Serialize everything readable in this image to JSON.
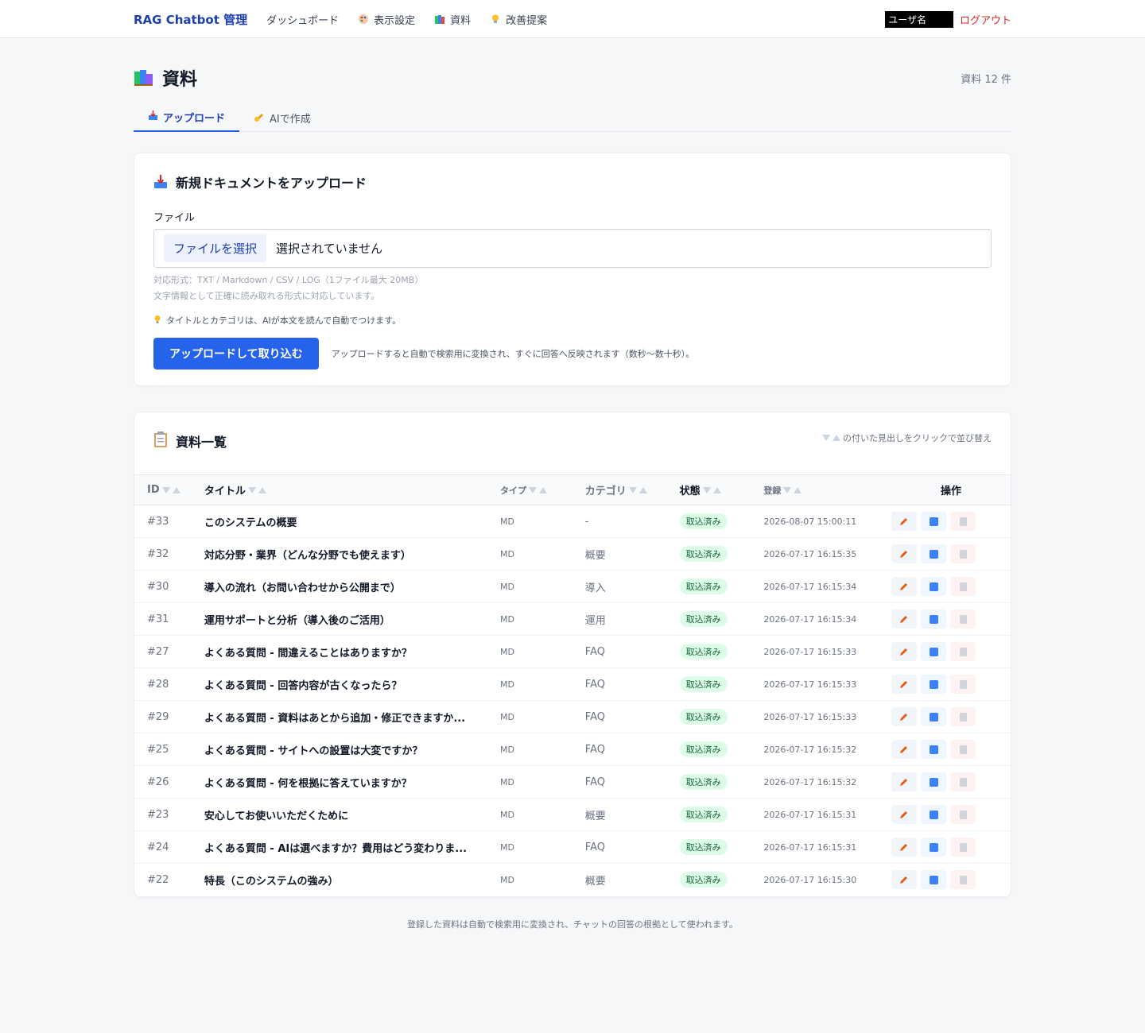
{
  "nav": {
    "brand": "RAG Chatbot 管理",
    "links": [
      {
        "label": "ダッシュボード",
        "icon": ""
      },
      {
        "label": "表示設定",
        "icon": "palette-icon"
      },
      {
        "label": "資料",
        "icon": "books-icon"
      },
      {
        "label": "改善提案",
        "icon": "lightbulb-icon"
      }
    ],
    "username": "ユーザ名",
    "logout": "ログアウト"
  },
  "page": {
    "title": "資料",
    "count": "資料 12 件"
  },
  "tabs": [
    {
      "label": "アップロード",
      "icon": "inbox-tray-icon",
      "active": true
    },
    {
      "label": "AIで作成",
      "icon": "writing-hand-icon",
      "active": false
    }
  ],
  "upload": {
    "title": "新規ドキュメントをアップロード",
    "file_label": "ファイル",
    "file_button": "ファイルを選択",
    "file_status": "選択されていません",
    "hint_formats": "対応形式：TXT / Markdown / CSV / LOG（1ファイル最大 20MB）",
    "hint_text": "文字情報として正確に読み取れる形式に対応しています。",
    "tip": "タイトルとカテゴリは、AIが本文を読んで自動でつけます。",
    "submit": "アップロードして取り込む",
    "submit_note": "アップロードすると自動で検索用に変換され、すぐに回答へ反映されます（数秒〜数十秒）。"
  },
  "list": {
    "title": "資料一覧",
    "sort_hint": "の付いた見出しをクリックで並び替え",
    "columns": {
      "id": "ID",
      "title": "タイトル",
      "type": "タイプ",
      "category": "カテゴリ",
      "state": "状態",
      "date": "登録",
      "ops": "操作"
    },
    "rows": [
      {
        "id": "#33",
        "title": "このシステムの概要",
        "type": "MD",
        "category": "-",
        "state": "取込済み",
        "date": "2026-08-07 15:00:11"
      },
      {
        "id": "#32",
        "title": "対応分野・業界（どんな分野でも使えます）",
        "type": "MD",
        "category": "概要",
        "state": "取込済み",
        "date": "2026-07-17 16:15:35"
      },
      {
        "id": "#30",
        "title": "導入の流れ（お問い合わせから公開まで）",
        "type": "MD",
        "category": "導入",
        "state": "取込済み",
        "date": "2026-07-17 16:15:34"
      },
      {
        "id": "#31",
        "title": "運用サポートと分析（導入後のご活用）",
        "type": "MD",
        "category": "運用",
        "state": "取込済み",
        "date": "2026-07-17 16:15:34"
      },
      {
        "id": "#27",
        "title": "よくある質問 - 間違えることはありますか？",
        "type": "MD",
        "category": "FAQ",
        "state": "取込済み",
        "date": "2026-07-17 16:15:33"
      },
      {
        "id": "#28",
        "title": "よくある質問 - 回答内容が古くなったら？",
        "type": "MD",
        "category": "FAQ",
        "state": "取込済み",
        "date": "2026-07-17 16:15:33"
      },
      {
        "id": "#29",
        "title": "よくある質問 - 資料はあとから追加・修正できますか...",
        "type": "MD",
        "category": "FAQ",
        "state": "取込済み",
        "date": "2026-07-17 16:15:33"
      },
      {
        "id": "#25",
        "title": "よくある質問 - サイトへの設置は大変ですか？",
        "type": "MD",
        "category": "FAQ",
        "state": "取込済み",
        "date": "2026-07-17 16:15:32"
      },
      {
        "id": "#26",
        "title": "よくある質問 - 何を根拠に答えていますか？",
        "type": "MD",
        "category": "FAQ",
        "state": "取込済み",
        "date": "2026-07-17 16:15:32"
      },
      {
        "id": "#23",
        "title": "安心してお使いいただくために",
        "type": "MD",
        "category": "概要",
        "state": "取込済み",
        "date": "2026-07-17 16:15:31"
      },
      {
        "id": "#24",
        "title": "よくある質問 - AIは選べますか？費用はどう変わりま...",
        "type": "MD",
        "category": "FAQ",
        "state": "取込済み",
        "date": "2026-07-17 16:15:31"
      },
      {
        "id": "#22",
        "title": "特長（このシステムの強み）",
        "type": "MD",
        "category": "概要",
        "state": "取込済み",
        "date": "2026-07-17 16:15:30"
      }
    ]
  },
  "footer": "登録した資料は自動で検索用に変換され、チャットの回答の根拠として使われます。",
  "colors": {
    "accent": "#2563eb",
    "brand": "#1e40af",
    "success_bg": "#dcfce7",
    "danger": "#dc2626"
  }
}
